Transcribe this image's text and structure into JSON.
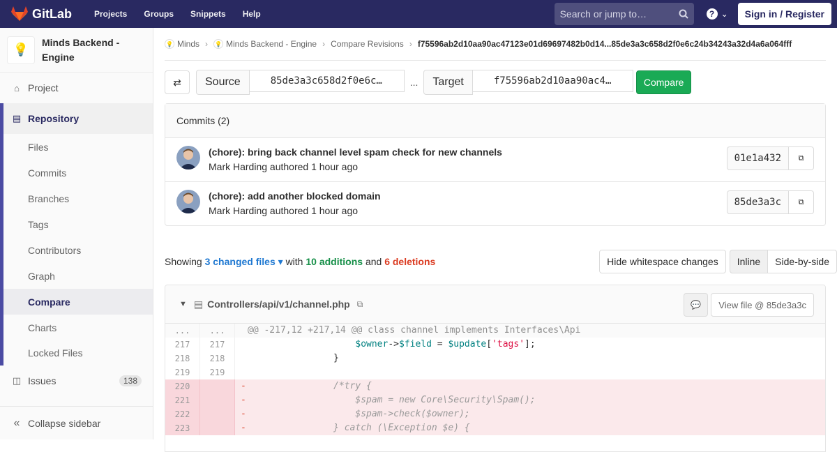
{
  "nav": {
    "brand": "GitLab",
    "links": [
      "Projects",
      "Groups",
      "Snippets",
      "Help"
    ],
    "search_placeholder": "Search or jump to…",
    "signin": "Sign in / Register",
    "accent": "#292961"
  },
  "sidebar": {
    "project_name": "Minds Backend - Engine",
    "project": "Project",
    "repository": "Repository",
    "items": [
      "Files",
      "Commits",
      "Branches",
      "Tags",
      "Contributors",
      "Graph",
      "Compare",
      "Charts",
      "Locked Files"
    ],
    "active_item": "Compare",
    "issues": "Issues",
    "issues_count": "138",
    "collapse": "Collapse sidebar"
  },
  "breadcrumb": {
    "group": "Minds",
    "project": "Minds Backend - Engine",
    "page": "Compare Revisions",
    "current": "f75596ab2d10aa90ac47123e01d69697482b0d14...85de3a3c658d2f0e6c24b34243a32d4a6a064fff"
  },
  "compare": {
    "source_label": "Source",
    "source_value": "85de3a3c658d2f0e6c…",
    "separator": "...",
    "target_label": "Target",
    "target_value": "f75596ab2d10aa90ac4…",
    "button": "Compare"
  },
  "commits": {
    "header": "Commits (2)",
    "list": [
      {
        "title": "(chore): bring back channel level spam check for new channels",
        "author": "Mark Harding",
        "meta": " authored 1 hour ago",
        "sha": "01e1a432"
      },
      {
        "title": "(chore): add another blocked domain",
        "author": "Mark Harding",
        "meta": " authored 1 hour ago",
        "sha": "85de3a3c"
      }
    ]
  },
  "stats": {
    "showing": "Showing",
    "changed": "3 changed files",
    "with": "with",
    "additions": "10 additions",
    "and": "and",
    "deletions": "6 deletions",
    "hide_ws": "Hide whitespace changes",
    "inline": "Inline",
    "side_by_side": "Side-by-side"
  },
  "file": {
    "path": "Controllers/api/v1/channel.php",
    "view_file": "View file @ 85de3a3c",
    "hunk": "@@ -217,12 +217,14 @@ class channel implements Interfaces\\Api",
    "lines": [
      {
        "old": "217",
        "new": "217",
        "type": "ctx",
        "sign": " ",
        "code": "                    $owner->$field = $update['tags'];"
      },
      {
        "old": "218",
        "new": "218",
        "type": "ctx",
        "sign": " ",
        "code": "                }"
      },
      {
        "old": "219",
        "new": "219",
        "type": "ctx",
        "sign": " ",
        "code": ""
      },
      {
        "old": "220",
        "new": "",
        "type": "old",
        "sign": "-",
        "code": "                /*try {"
      },
      {
        "old": "221",
        "new": "",
        "type": "old",
        "sign": "-",
        "code": "                    $spam = new Core\\Security\\Spam();"
      },
      {
        "old": "222",
        "new": "",
        "type": "old",
        "sign": "-",
        "code": "                    $spam->check($owner);"
      },
      {
        "old": "223",
        "new": "",
        "type": "old",
        "sign": "-",
        "code": "                } catch (\\Exception $e) {"
      }
    ]
  }
}
